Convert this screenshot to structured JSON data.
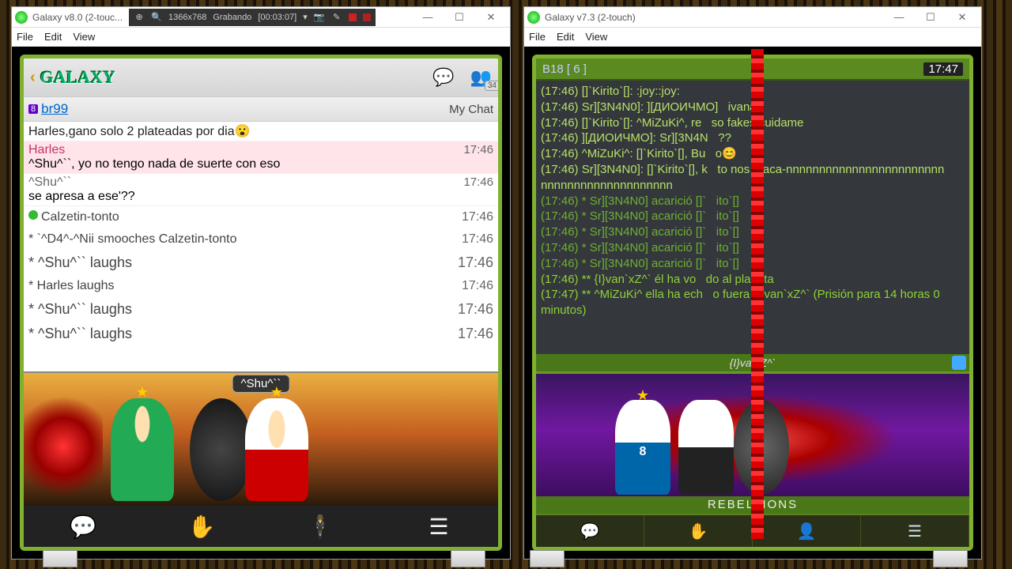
{
  "left_window": {
    "title": "Galaxy v8.0 (2-touc...",
    "rec": {
      "res": "1366x768",
      "label": "Grabando",
      "time": "[00:03:07]"
    },
    "menubar": [
      "File",
      "Edit",
      "View"
    ],
    "header": {
      "logo": "GALAXY",
      "badge": "34"
    },
    "room": {
      "badge": "8",
      "name": "br99",
      "mychat": "My Chat"
    },
    "messages": [
      {
        "type": "plain",
        "text": "Harles,gano solo 2 plateadas por dia😮"
      },
      {
        "type": "named",
        "name": "Harles",
        "text": "^Shu^``, yo no tengo nada de suerte con eso",
        "time": "17:46",
        "pink": true
      },
      {
        "type": "named",
        "name": "^Shu^``",
        "text": "se apresa a ese'??",
        "time": "17:46"
      },
      {
        "type": "presence",
        "text": "Calzetin-tonto",
        "time": "17:46"
      },
      {
        "type": "action",
        "text": "* `^D4^-^Nii smooches Calzetin-tonto",
        "time": "17:46"
      },
      {
        "type": "action",
        "text": "* ^Shu^`` laughs",
        "time": "17:46"
      },
      {
        "type": "action",
        "text": "* Harles laughs",
        "time": "17:46"
      },
      {
        "type": "action",
        "text": "* ^Shu^`` laughs",
        "time": "17:46"
      },
      {
        "type": "action",
        "text": "* ^Shu^`` laughs",
        "time": "17:46"
      }
    ],
    "stage_tag": "^Shu^``"
  },
  "right_window": {
    "title": "Galaxy v7.3 (2-touch)",
    "menubar": [
      "File",
      "Edit",
      "View"
    ],
    "room": {
      "name": "B18 [ 6 ]",
      "time": "17:47"
    },
    "lines": [
      "(17:46) []`Kirito`[]: :joy::joy:",
      "(17:46) Sr][3N4N0]: ][ДИОИЧМО]   ivana",
      "(17:46) []`Kirito`[]: ^MiZuKi^, re   so fakes cuidame",
      "(17:46) ][ДИОИЧМО]: Sr][3N4N   ??",
      "(17:46) ^MiZuKi^: []`Kirito`[], Bu   o😊",
      "(17:46) Sr][3N4N0]: []`Kirito`[], k   to nos ataca-nnnnnnnnnnnnnnnnnnnnnnnn   nnnnnnnnnnnnnnnnnnnn",
      "(17:46) * Sr][3N4N0] acarició []`   ito`[]",
      "(17:46) * Sr][3N4N0] acarició []`   ito`[]",
      "(17:46) * Sr][3N4N0] acarició []`   ito`[]",
      "(17:46) * Sr][3N4N0] acarició []`   ito`[]",
      "(17:46) * Sr][3N4N0] acarició []`   ito`[]",
      "(17:46) ** {I}van`xZ^` él ha vo   do al planeta",
      "(17:47) ** ^MiZuKi^ ella ha ech   o fuera {I}van`xZ^` (Prisión para 14 horas 0 minutos)"
    ],
    "stage_top": "{I}va  xZ^`",
    "stage_bot": "REBELLIONS",
    "avatar_num": "8"
  }
}
